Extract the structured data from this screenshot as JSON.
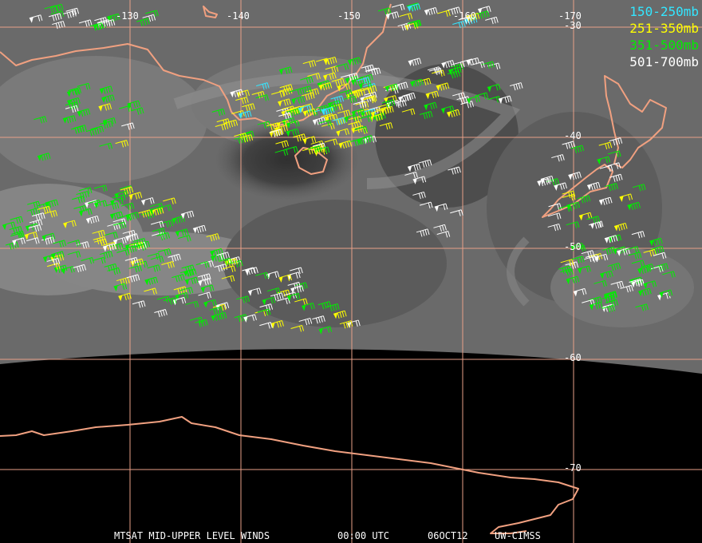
{
  "legend": [
    {
      "label": "150-250mb",
      "color": "#33e6ff"
    },
    {
      "label": "251-350mb",
      "color": "#ffff00"
    },
    {
      "label": "351-500mb",
      "color": "#00ee00"
    },
    {
      "label": "501-700mb",
      "color": "#ffffff"
    }
  ],
  "longitude_labels": [
    "-130",
    "-140",
    "-150",
    "-160",
    "-170"
  ],
  "latitude_labels": [
    "-30",
    "-40",
    "-50",
    "-60",
    "-70"
  ],
  "footer": {
    "product": "MTSAT MID-UPPER LEVEL WINDS",
    "time": "00:00 UTC",
    "date": "06OCT12",
    "source": "UW-CIMSS"
  },
  "colors": {
    "grid": "#e8a088",
    "coastline": "#f0a080",
    "night": "#000000"
  }
}
